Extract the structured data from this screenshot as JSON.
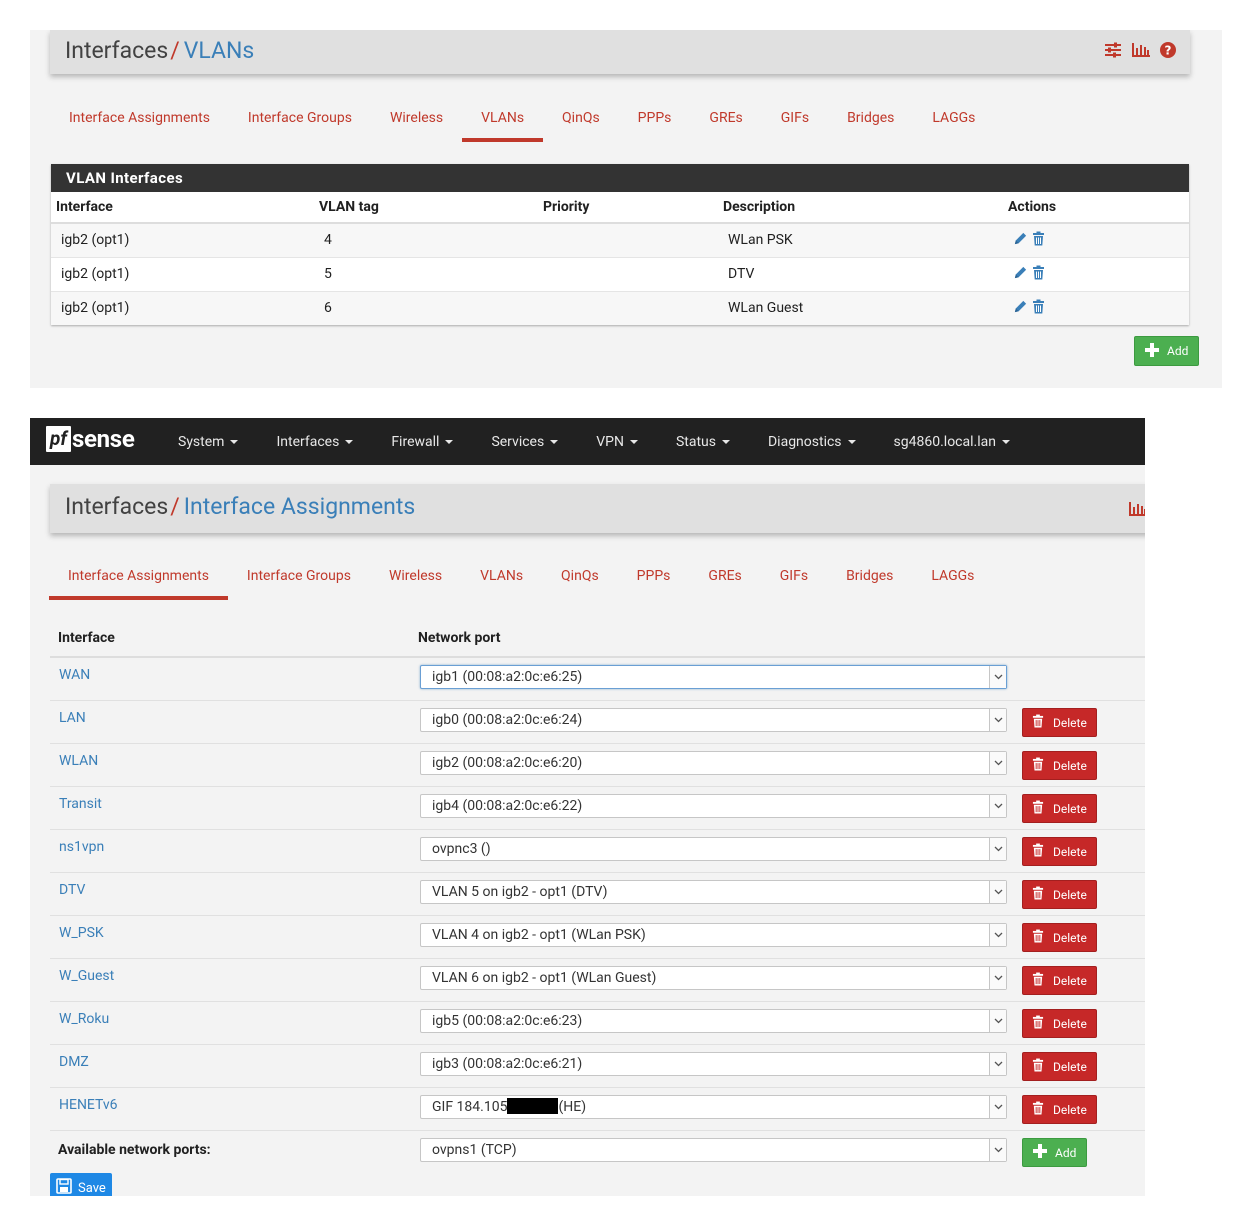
{
  "vlans_page": {
    "breadcrumb": {
      "section": "Interfaces",
      "separator": "/",
      "current": "VLANs"
    },
    "tabs": [
      {
        "label": "Interface Assignments",
        "active": false
      },
      {
        "label": "Interface Groups",
        "active": false
      },
      {
        "label": "Wireless",
        "active": false
      },
      {
        "label": "VLANs",
        "active": true
      },
      {
        "label": "QinQs",
        "active": false
      },
      {
        "label": "PPPs",
        "active": false
      },
      {
        "label": "GREs",
        "active": false
      },
      {
        "label": "GIFs",
        "active": false
      },
      {
        "label": "Bridges",
        "active": false
      },
      {
        "label": "LAGGs",
        "active": false
      }
    ],
    "panel_title": "VLAN Interfaces",
    "columns": [
      "Interface",
      "VLAN tag",
      "Priority",
      "Description",
      "Actions"
    ],
    "rows": [
      {
        "interface": "igb2 (opt1)",
        "tag": "4",
        "priority": "",
        "description": "WLan PSK"
      },
      {
        "interface": "igb2 (opt1)",
        "tag": "5",
        "priority": "",
        "description": "DTV"
      },
      {
        "interface": "igb2 (opt1)",
        "tag": "6",
        "priority": "",
        "description": "WLan Guest"
      }
    ],
    "add_label": "Add"
  },
  "navbar": {
    "logo_pf": "pf",
    "logo_sense": "sense",
    "menu": [
      "System",
      "Interfaces",
      "Firewall",
      "Services",
      "VPN",
      "Status",
      "Diagnostics",
      "sg4860.local.lan"
    ]
  },
  "assign_page": {
    "breadcrumb": {
      "section": "Interfaces",
      "separator": "/",
      "current": "Interface Assignments"
    },
    "tabs": [
      {
        "label": "Interface Assignments",
        "active": true
      },
      {
        "label": "Interface Groups",
        "active": false
      },
      {
        "label": "Wireless",
        "active": false
      },
      {
        "label": "VLANs",
        "active": false
      },
      {
        "label": "QinQs",
        "active": false
      },
      {
        "label": "PPPs",
        "active": false
      },
      {
        "label": "GREs",
        "active": false
      },
      {
        "label": "GIFs",
        "active": false
      },
      {
        "label": "Bridges",
        "active": false
      },
      {
        "label": "LAGGs",
        "active": false
      }
    ],
    "col_interface": "Interface",
    "col_port": "Network port",
    "rows": [
      {
        "name": "WAN",
        "port": "igb1 (00:08:a2:0c:e6:25)"
      },
      {
        "name": "LAN",
        "port": "igb0 (00:08:a2:0c:e6:24)"
      },
      {
        "name": "WLAN",
        "port": "igb2 (00:08:a2:0c:e6:20)"
      },
      {
        "name": "Transit",
        "port": "igb4 (00:08:a2:0c:e6:22)"
      },
      {
        "name": "ns1vpn",
        "port": "ovpnc3 ()"
      },
      {
        "name": "DTV",
        "port": "VLAN 5 on igb2 - opt1 (DTV)"
      },
      {
        "name": "W_PSK",
        "port": "VLAN 4 on igb2 - opt1 (WLan PSK)"
      },
      {
        "name": "W_Guest",
        "port": "VLAN 6 on igb2 - opt1 (WLan Guest)"
      },
      {
        "name": "W_Roku",
        "port": "igb5 (00:08:a2:0c:e6:23)"
      },
      {
        "name": "DMZ",
        "port": "igb3 (00:08:a2:0c:e6:21)"
      },
      {
        "name": "HENETv6",
        "port_prefix": "GIF 184.105",
        "port_suffix": "(HE)"
      }
    ],
    "delete_label": "Delete",
    "available_label": "Available network ports:",
    "available_value": "ovpns1 (TCP)",
    "add_label": "Add",
    "save_label": "Save"
  },
  "colors": {
    "accent_red": "#c0392b",
    "link_blue": "#3a7fb8",
    "navbar": "#212121",
    "success": "#4caf50",
    "danger": "#c62828",
    "primary": "#1e88e5"
  }
}
